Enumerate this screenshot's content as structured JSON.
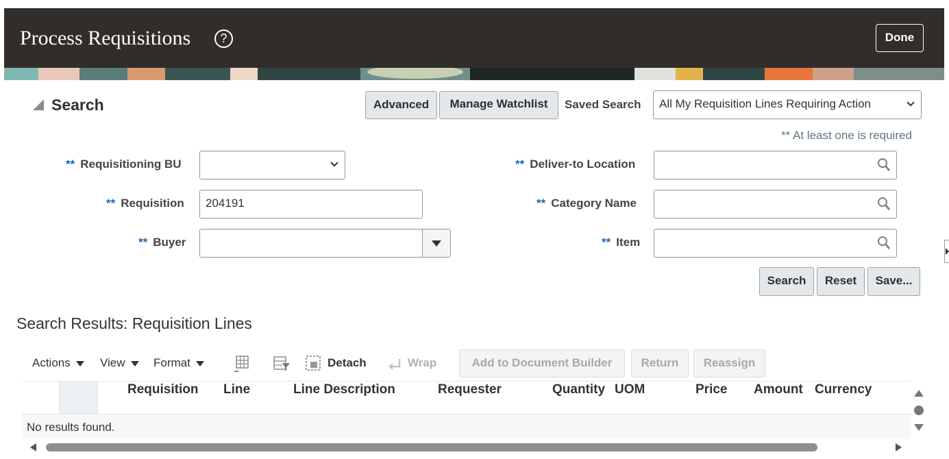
{
  "page": {
    "title": "Process Requisitions",
    "help_icon": "?",
    "done_label": "Done"
  },
  "search": {
    "heading": "Search",
    "advanced_label": "Advanced",
    "manage_watchlist_label": "Manage Watchlist",
    "saved_search_label": "Saved Search",
    "saved_search_value": "All My Requisition Lines Requiring Action",
    "required_hint": "** At least one is required",
    "required_marker": "**",
    "fields": {
      "requisitioning_bu": {
        "label": "Requisitioning BU",
        "value": ""
      },
      "requisition": {
        "label": "Requisition",
        "value": "204191"
      },
      "buyer": {
        "label": "Buyer",
        "value": ""
      },
      "deliver_to_location": {
        "label": "Deliver-to Location",
        "value": ""
      },
      "category_name": {
        "label": "Category Name",
        "value": ""
      },
      "item": {
        "label": "Item",
        "value": ""
      }
    },
    "buttons": {
      "search": "Search",
      "reset": "Reset",
      "save": "Save..."
    }
  },
  "results": {
    "heading": "Search Results: Requisition Lines",
    "toolbar": {
      "actions": "Actions",
      "view": "View",
      "format": "Format",
      "detach": "Detach",
      "wrap": "Wrap",
      "add_to_document_builder": "Add to Document Builder",
      "return": "Return",
      "reassign": "Reassign"
    },
    "columns": [
      "Requisition",
      "Line",
      "Line Description",
      "Requester",
      "Quantity",
      "UOM",
      "Price",
      "Amount",
      "Currency"
    ],
    "empty_message": "No results found."
  },
  "icons": {
    "help": "help-icon",
    "dropdown": "chevron-down-icon",
    "lookup": "search-icon",
    "freeze": "freeze-columns-icon",
    "query_by_example": "query-by-example-icon",
    "detach": "detach-icon",
    "wrap": "wrap-icon"
  },
  "colors": {
    "header_bg": "#312d2a",
    "required": "#1a67b3",
    "button_bg": "#e4e8ea"
  }
}
